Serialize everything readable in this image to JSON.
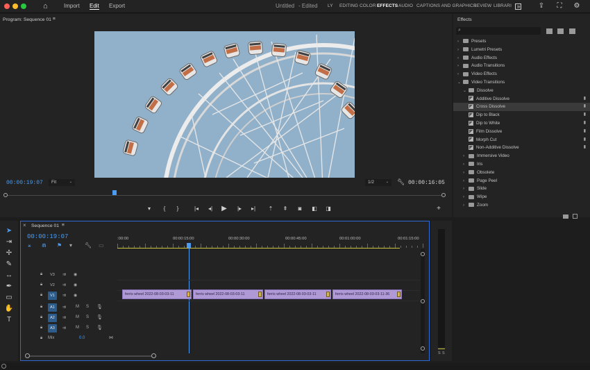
{
  "topbar": {
    "nav": [
      "Import",
      "Edit",
      "Export"
    ],
    "active_nav": "Edit",
    "doc_title": "Untitled",
    "doc_status": "- Edited",
    "workspaces": [
      "LY",
      "EDITING",
      "COLOR",
      "EFFECTS",
      "AUDIO",
      "CAPTIONS AND GRAPHICS",
      "REVIEW",
      "LIBRARI"
    ],
    "active_workspace": "EFFECTS",
    "window_colors": [
      "#ff5f57",
      "#febc2e",
      "#28c840"
    ]
  },
  "program": {
    "title": "Program: Sequence 01",
    "menu_icon": "≡",
    "timecode_left": "00:00:19:07",
    "fit": "Fit",
    "resolution": "1/2",
    "timecode_right": "00:00:16:05"
  },
  "effects": {
    "title": "Effects",
    "menu_icon": "≡",
    "search_placeholder": "",
    "items": [
      {
        "label": "Presets",
        "kind": "folder",
        "level": 0,
        "expanded": false
      },
      {
        "label": "Lumetri Presets",
        "kind": "folder",
        "level": 0,
        "expanded": false
      },
      {
        "label": "Audio Effects",
        "kind": "folder",
        "level": 0,
        "expanded": false
      },
      {
        "label": "Audio Transitions",
        "kind": "folder",
        "level": 0,
        "expanded": false
      },
      {
        "label": "Video Effects",
        "kind": "folder",
        "level": 0,
        "expanded": false
      },
      {
        "label": "Video Transitions",
        "kind": "folder",
        "level": 0,
        "expanded": true
      },
      {
        "label": "Dissolve",
        "kind": "folder",
        "level": 1,
        "expanded": true
      },
      {
        "label": "Additive Dissolve",
        "kind": "effect",
        "level": 2
      },
      {
        "label": "Cross Dissolve",
        "kind": "effect",
        "level": 2,
        "selected": true
      },
      {
        "label": "Dip to Black",
        "kind": "effect",
        "level": 2
      },
      {
        "label": "Dip to White",
        "kind": "effect",
        "level": 2
      },
      {
        "label": "Film Dissolve",
        "kind": "effect",
        "level": 2
      },
      {
        "label": "Morph Cut",
        "kind": "effect",
        "level": 2
      },
      {
        "label": "Non-Additive Dissolve",
        "kind": "effect",
        "level": 2
      },
      {
        "label": "Immersive Video",
        "kind": "folder",
        "level": 1,
        "expanded": false
      },
      {
        "label": "Iris",
        "kind": "folder",
        "level": 1,
        "expanded": false
      },
      {
        "label": "Obsolete",
        "kind": "folder",
        "level": 1,
        "expanded": false
      },
      {
        "label": "Page Peel",
        "kind": "folder",
        "level": 1,
        "expanded": false
      },
      {
        "label": "Slide",
        "kind": "folder",
        "level": 1,
        "expanded": false
      },
      {
        "label": "Wipe",
        "kind": "folder",
        "level": 1,
        "expanded": false
      },
      {
        "label": "Zoom",
        "kind": "folder",
        "level": 1,
        "expanded": false
      }
    ]
  },
  "timeline": {
    "title": "Sequence 01",
    "menu_icon": "≡",
    "timecode": "00:00:19:07",
    "ruler": [
      ":00:00",
      "00:00:15:00",
      "00:00:30:00",
      "00:00:45:00",
      "00:01:00:00",
      "00:01:15:00"
    ],
    "video_tracks": [
      "V3",
      "V2",
      "V1"
    ],
    "audio_tracks": [
      "A1",
      "A2",
      "A3"
    ],
    "mix_label": "Mix",
    "mix_value": "0.0",
    "clips": [
      "ferris wheel 2022-08-03-03-11",
      "ferris wheel 2022-08-03-03-11",
      "ferris wheel 2022-08-03-03-11",
      "ferris wheel 2022-08-03-03-11-36"
    ]
  },
  "meter": {
    "solo_labels": [
      "S",
      "S"
    ]
  },
  "colors": {
    "accent_blue": "#4b9cf0",
    "clip_purple": "#b09ad6",
    "panel_border_active": "#2d6ad6"
  }
}
